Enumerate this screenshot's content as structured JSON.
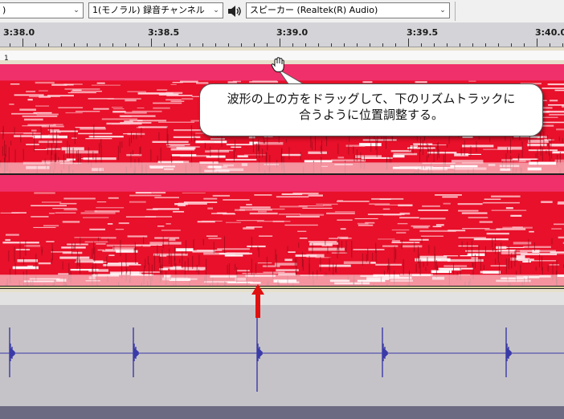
{
  "toolbar": {
    "host_dropdown_value": ")",
    "channel_dropdown_value": "1(モノラル) 録音チャンネル",
    "speaker_icon": "speaker-icon",
    "output_dropdown_value": "スピーカー (Realtek(R) Audio)"
  },
  "ruler": {
    "ticks": [
      "3:38.0",
      "3:38.5",
      "3:39.0",
      "3:39.5",
      "3:40.0"
    ]
  },
  "track1": {
    "number": "1",
    "view": "spectrogram"
  },
  "tooltip": {
    "line1": "波形の上の方をドラッグして、下のリズムトラックに",
    "line2": "合うように位置調整する。"
  },
  "colors": {
    "spectrogram_red": "#e8102a",
    "waveform_blue": "#3a3aa8",
    "arrow_red": "#e01010"
  },
  "icons": {
    "cursor": "hand-cursor-icon",
    "marker": "up-arrow-icon"
  }
}
